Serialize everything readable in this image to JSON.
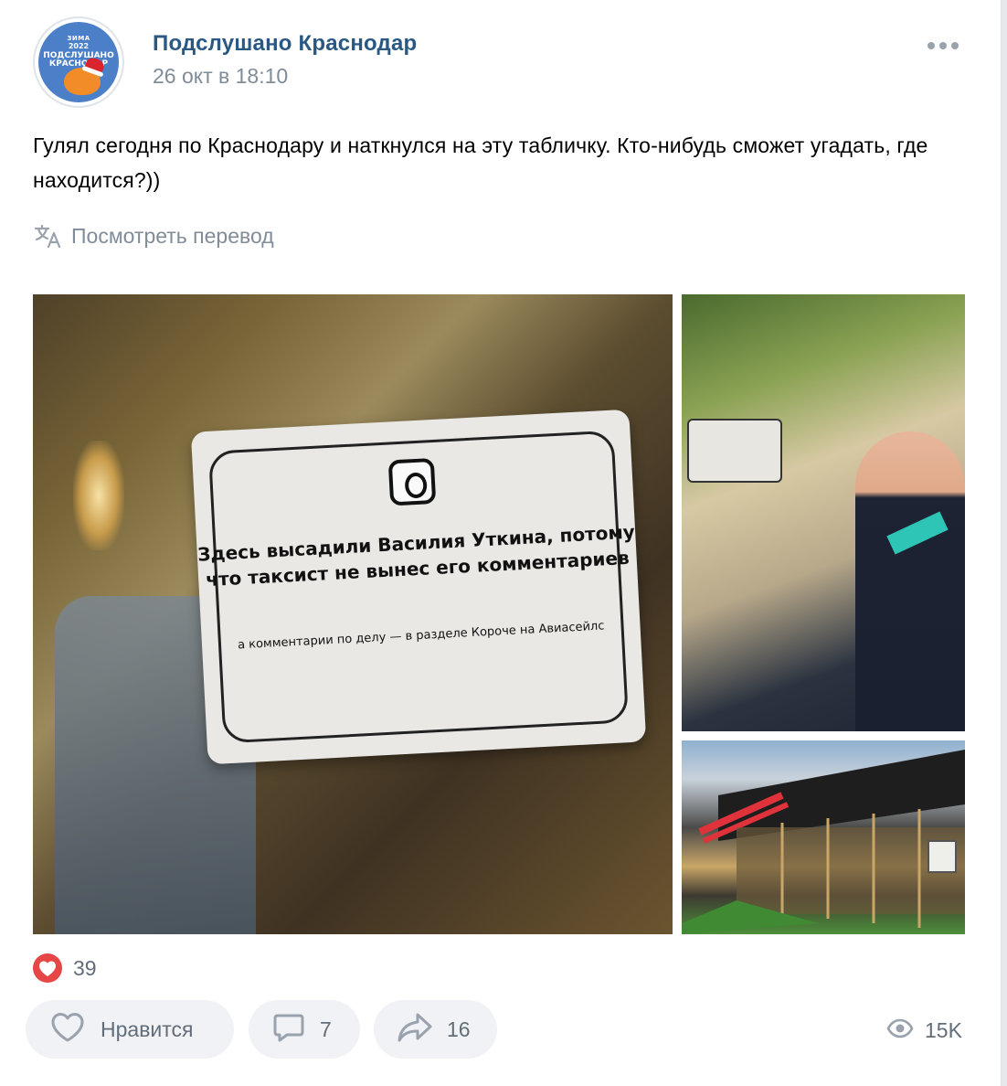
{
  "post": {
    "group_name": "Подслушано Краснодар",
    "date": "26 окт в 18:10",
    "text": "Гулял сегодня по Краснодару и наткнулся на эту табличку. Кто-нибудь сможет угадать, где находится?))",
    "translate_label": "Посмотреть перевод",
    "avatar": {
      "line1": "ЗИМА",
      "line2": "2022",
      "line3": "ПОДСЛУШАНО",
      "line4": "КРАСНОДАР"
    }
  },
  "photos": {
    "main": {
      "plate_title": "Здесь высадили Василия Уткина, потому что таксист не вынес его комментариев",
      "plate_subtitle": "а комментарии по делу — в разделе Короче на Авиасейлс"
    }
  },
  "reactions": {
    "icon": "heart-icon",
    "count": "39"
  },
  "actions": {
    "like_label": "Нравится",
    "comment_count": "7",
    "share_count": "16",
    "views_count": "15K"
  },
  "colors": {
    "link": "#2a5885",
    "secondary": "#818c99",
    "button_bg": "#f0f2f5",
    "heart": "#e64646"
  }
}
